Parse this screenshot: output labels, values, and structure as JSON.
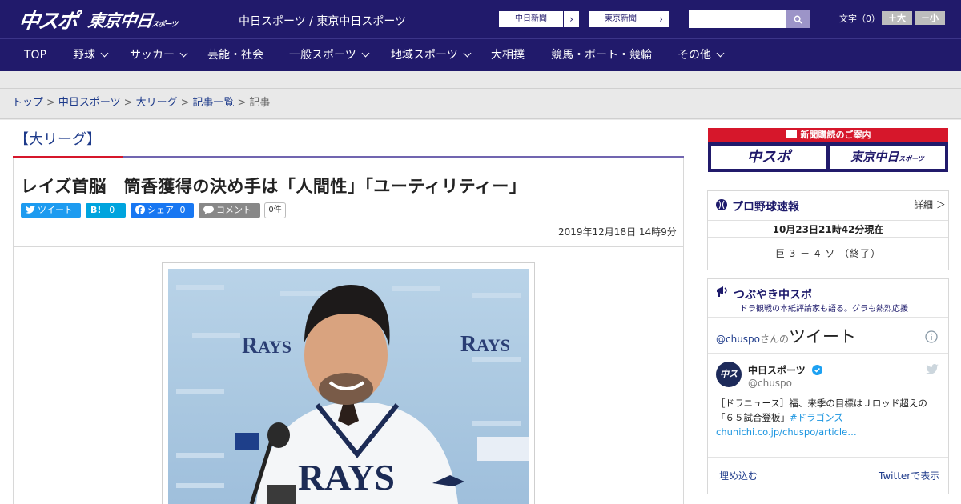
{
  "header": {
    "logo_chuspo": "中スポ",
    "logo_tokyo": "東京中日",
    "logo_tokyo_small": "スポーツ",
    "site_name": "中日スポーツ / 東京中日スポーツ",
    "ext_links": [
      "中日新聞",
      "東京新聞"
    ],
    "search_placeholder": "",
    "font_label": "文字（0）",
    "font_bigger": "＋大",
    "font_smaller": "－小"
  },
  "nav": {
    "items": [
      {
        "label": "TOP",
        "has_menu": false
      },
      {
        "label": "野球",
        "has_menu": true
      },
      {
        "label": "サッカー",
        "has_menu": true
      },
      {
        "label": "芸能・社会",
        "has_menu": false
      },
      {
        "label": "一般スポーツ",
        "has_menu": true
      },
      {
        "label": "地域スポーツ",
        "has_menu": true
      },
      {
        "label": "大相撲",
        "has_menu": false
      },
      {
        "label": "競馬・ボート・競輪",
        "has_menu": false
      },
      {
        "label": "その他",
        "has_menu": true
      }
    ]
  },
  "breadcrumb": {
    "items": [
      "トップ",
      "中日スポーツ",
      "大リーグ",
      "記事一覧"
    ],
    "current": "記事",
    "sep": ">"
  },
  "article": {
    "category": "【大リーグ】",
    "headline": "レイズ首脳　筒香獲得の決め手は「人間性」「ユーティリティー」",
    "share": {
      "tweet": "ツイート",
      "hatena": "B!",
      "hatena_count": "0",
      "facebook": "シェア",
      "facebook_count": "0",
      "comment": "コメント",
      "comment_count": "0件"
    },
    "date": "2019年12月18日 14時9分"
  },
  "sidebar": {
    "promo_bar": "新聞購読のご案内",
    "promo_tiles": [
      "中スポ",
      "東京中日"
    ],
    "promo_tile_small": "スポーツ",
    "score": {
      "title": "プロ野球速報",
      "more": "詳細 ＞",
      "date": "10月23日21時42分現在",
      "line": "巨 3 － 4 ソ （終了）"
    },
    "tweets": {
      "title": "つぶやき中スポ",
      "subtitle": "ドラ観戦の本紙評論家も語る。グラも熱烈応援",
      "handle_prefix": "@chuspo",
      "handle_suffix": "さんの",
      "big": "ツイート",
      "account_name": "中日スポーツ",
      "account_handle": "@chuspo",
      "avatar_text": "中スポ",
      "tweet_line1": "［ドラニュース］福、来季の目標はＪロッド超えの",
      "tweet_line2_a": "「６５試合登板」",
      "tweet_line2_b": "#ドラゴンズ",
      "tweet_line3": "chunichi.co.jp/chuspo/article…",
      "embed": "埋め込む",
      "view_on_twitter": "Twitterで表示"
    }
  }
}
